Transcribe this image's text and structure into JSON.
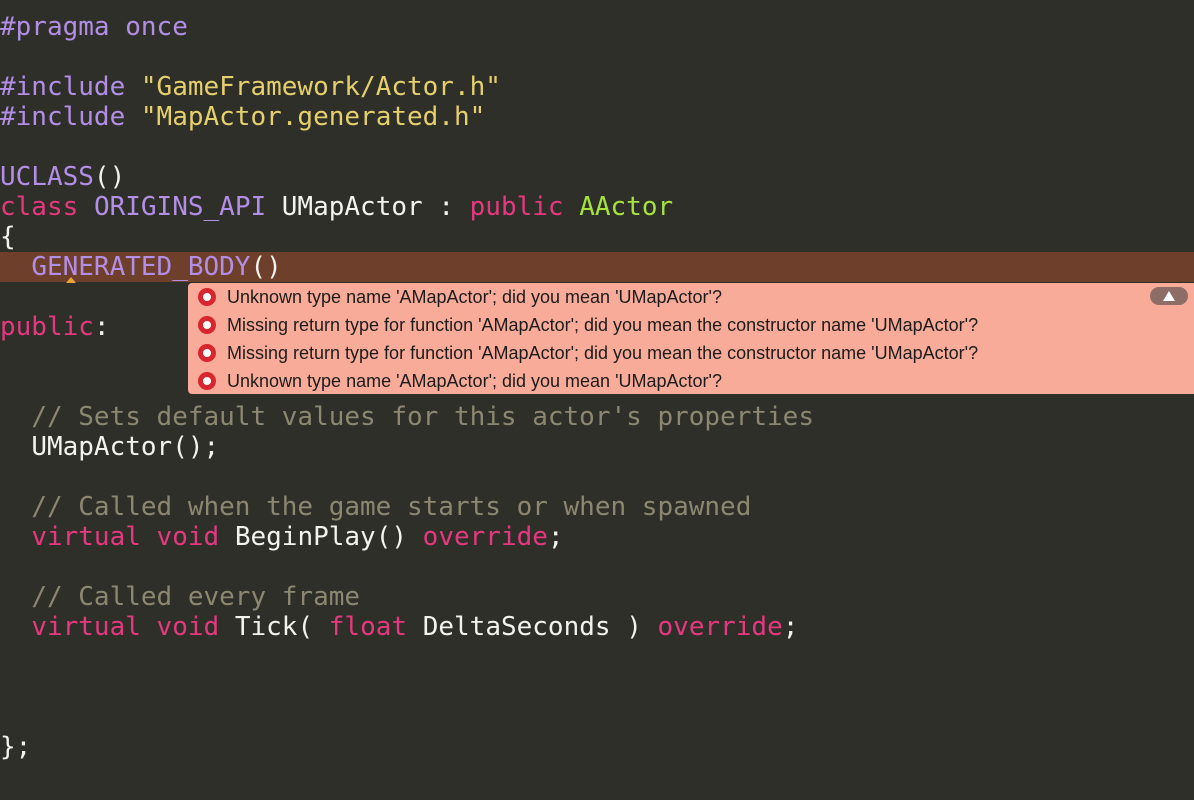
{
  "code": {
    "l1_pragma": "#pragma",
    "l1_once": "once",
    "l3_include": "#include",
    "l3_path": "\"GameFramework/Actor.h\"",
    "l4_include": "#include",
    "l4_path": "\"MapActor.generated.h\"",
    "l6_uclass": "UCLASS",
    "l6_parens": "()",
    "l7_class": "class",
    "l7_api": "ORIGINS_API",
    "l7_name": "UMapActor",
    "l7_colon": ":",
    "l7_public": "public",
    "l7_base": "AActor",
    "l8_brace": "{",
    "l9_generated": "GENERATED_BODY",
    "l9_parens": "()",
    "l11_public": "public",
    "l11_colon": ":",
    "l14_comment": "// Sets default values for this actor's properties",
    "l15_ctor": "UMapActor();",
    "l17_comment": "// Called when the game starts or when spawned",
    "l18_virtual": "virtual",
    "l18_void": "void",
    "l18_fn": "BeginPlay()",
    "l18_override": "override",
    "l18_semi": ";",
    "l20_comment": "// Called every frame",
    "l21_virtual": "virtual",
    "l21_void": "void",
    "l21_fn": "Tick(",
    "l21_float": "float",
    "l21_param": "DeltaSeconds )",
    "l21_override": "override",
    "l21_semi": ";",
    "l25_close": "};"
  },
  "issues": [
    {
      "severity": "error",
      "message": "Unknown type name 'AMapActor'; did you mean 'UMapActor'?"
    },
    {
      "severity": "error",
      "message": "Missing return type for function 'AMapActor'; did you mean the constructor name 'UMapActor'?"
    },
    {
      "severity": "error",
      "message": "Missing return type for function 'AMapActor'; did you mean the constructor name 'UMapActor'?"
    },
    {
      "severity": "error",
      "message": "Unknown type name 'AMapActor'; did you mean 'UMapActor'?"
    }
  ],
  "colors": {
    "background": "#2f2f2a",
    "error_line": "#6e3f2b",
    "issue_panel": "#f8ab98",
    "error_icon": "#d8262e",
    "keyword": "#e6387f",
    "preprocessor": "#b28ee6",
    "string": "#e6d06c",
    "type": "#a6e33d",
    "comment": "#8b8770"
  },
  "icons": {
    "issue_icon": "error-circle-icon",
    "collapse": "collapse-up-triangle-icon",
    "warning_caret": "warning-caret-icon"
  }
}
